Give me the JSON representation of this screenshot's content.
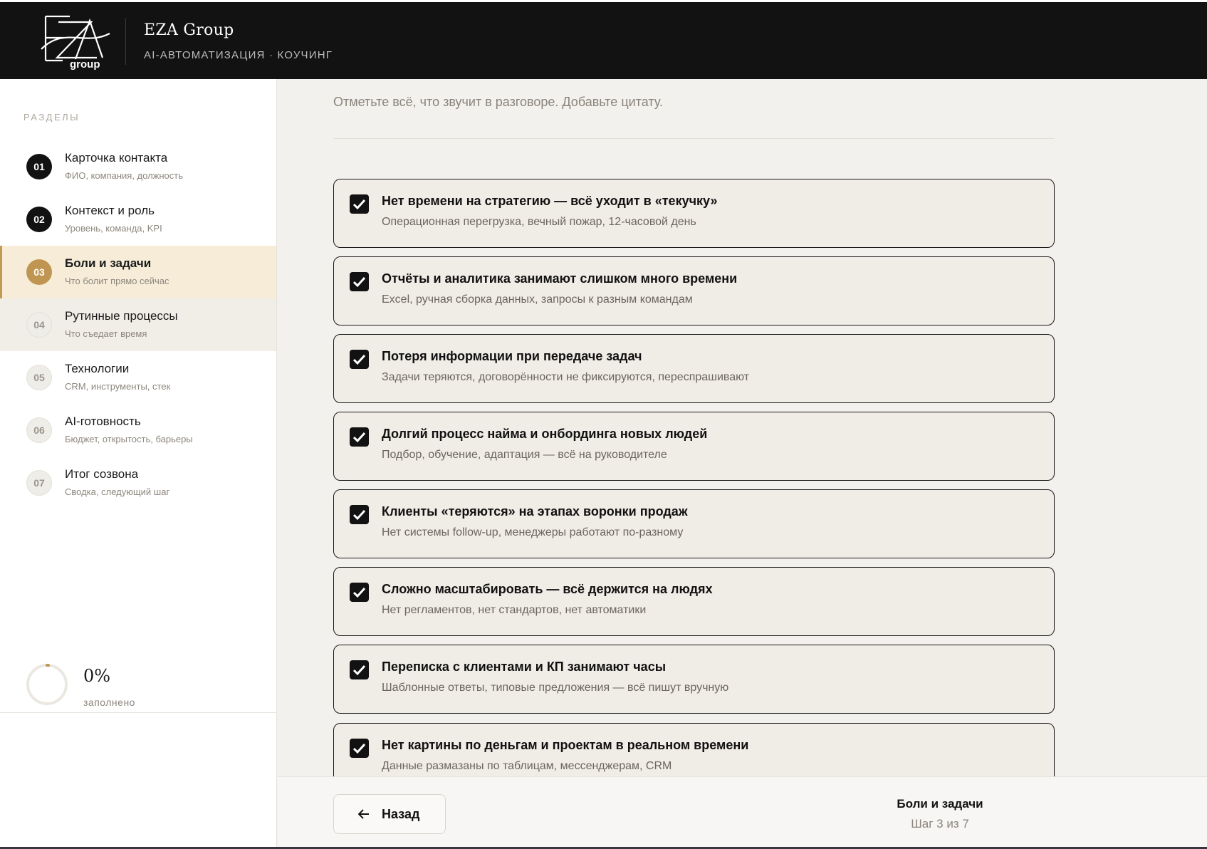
{
  "header": {
    "brand": "EZA Group",
    "tagline": "AI-АВТОМАТИЗАЦИЯ · КОУЧИНГ",
    "logo_text": "EZA group"
  },
  "sidebar": {
    "title": "РАЗДЕЛЫ",
    "items": [
      {
        "num": "01",
        "label": "Карточка контакта",
        "sub": "ФИО, компания, должность",
        "state": "done"
      },
      {
        "num": "02",
        "label": "Контекст и роль",
        "sub": "Уровень, команда, KPI",
        "state": "done"
      },
      {
        "num": "03",
        "label": "Боли и задачи",
        "sub": "Что болит прямо сейчас",
        "state": "current"
      },
      {
        "num": "04",
        "label": "Рутинные процессы",
        "sub": "Что съедает время",
        "state": "todo"
      },
      {
        "num": "05",
        "label": "Технологии",
        "sub": "CRM, инструменты, стек",
        "state": "todo"
      },
      {
        "num": "06",
        "label": "AI-готовность",
        "sub": "Бюджет, открытость, барьеры",
        "state": "todo"
      },
      {
        "num": "07",
        "label": "Итог созвона",
        "sub": "Сводка, следующий шаг",
        "state": "todo"
      }
    ],
    "progress": {
      "value": 0,
      "text": "0%",
      "label": "заполнено"
    }
  },
  "main": {
    "subtitle": "Отметьте всё, что звучит в разговоре. Добавьте цитату.",
    "options": [
      {
        "title": "Нет времени на стратегию — всё уходит в «текучку»",
        "desc": "Операционная перегрузка, вечный пожар, 12-часовой день",
        "checked": true
      },
      {
        "title": "Отчёты и аналитика занимают слишком много времени",
        "desc": "Excel, ручная сборка данных, запросы к разным командам",
        "checked": true
      },
      {
        "title": "Потеря информации при передаче задач",
        "desc": "Задачи теряются, договорённости не фиксируются, переспрашивают",
        "checked": true
      },
      {
        "title": "Долгий процесс найма и онбординга новых людей",
        "desc": "Подбор, обучение, адаптация — всё на руководителе",
        "checked": true
      },
      {
        "title": "Клиенты «теряются» на этапах воронки продаж",
        "desc": "Нет системы follow-up, менеджеры работают по-разному",
        "checked": true
      },
      {
        "title": "Сложно масштабировать — всё держится на людях",
        "desc": "Нет регламентов, нет стандартов, нет автоматики",
        "checked": true
      },
      {
        "title": "Переписка с клиентами и КП занимают часы",
        "desc": "Шаблонные ответы, типовые предложения — всё пишут вручную",
        "checked": true
      },
      {
        "title": "Нет картины по деньгам и проектам в реальном времени",
        "desc": "Данные размазаны по таблицам, мессенджерам, CRM",
        "checked": true
      }
    ]
  },
  "footer": {
    "back_label": "Назад",
    "step_title": "Боли и задачи",
    "step_count": "Шаг 3 из 7"
  },
  "colors": {
    "accent": "#c09552",
    "dark": "#121212",
    "active_bg": "#f6ecd8"
  }
}
